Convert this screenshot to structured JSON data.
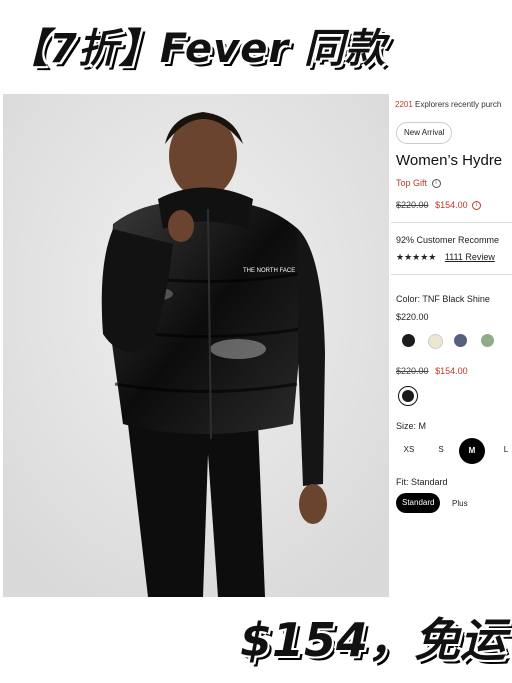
{
  "banner_top": "【7折】Fever 同款",
  "banner_bottom": "$154，免运",
  "product": {
    "explorers_count": "2201",
    "explorers_text": "Explorers recently purch",
    "badge": "New Arrival",
    "title": "Women’s Hydre",
    "top_gift": "Top Gift",
    "original_price": "$220.00",
    "sale_price": "$154.00",
    "recommend": "92% Customer Recomme",
    "rating_stars": 4.5,
    "reviews": "1111 Review",
    "color_label": "Color: TNF Black Shine",
    "color_price": "$220.00",
    "swatches": [
      {
        "name": "black",
        "hex": "#1c1c1c"
      },
      {
        "name": "cream",
        "hex": "#ece6d3"
      },
      {
        "name": "navy-grey",
        "hex": "#556080"
      },
      {
        "name": "sage",
        "hex": "#8fab88"
      }
    ],
    "selected_original_price": "$220.00",
    "selected_sale_price": "$154.00",
    "size_label": "Size: M",
    "sizes": [
      "XS",
      "S",
      "M",
      "L"
    ],
    "selected_size": "M",
    "fit_label": "Fit: Standard",
    "fits": [
      "Standard",
      "Plus"
    ],
    "brand_logo_text": "THE NORTH FACE"
  },
  "colors": {
    "sale": "#c0392b",
    "photo_bg": "#e7e7e7"
  }
}
